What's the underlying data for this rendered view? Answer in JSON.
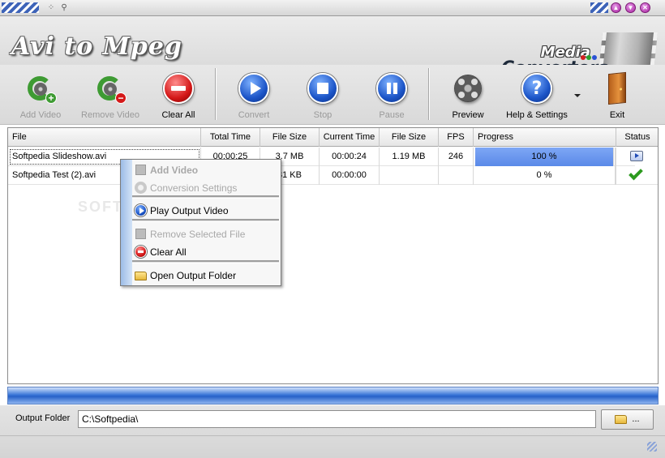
{
  "window": {
    "title_bar_buttons": [
      "minimize",
      "maximize",
      "close"
    ],
    "title_bar_icons": [
      "grip-icon",
      "pin-icon"
    ]
  },
  "banner": {
    "app_title": "Avi to Mpeg",
    "brand_line1": "Media",
    "brand_line2": "Converters",
    "brand_dot_colors": [
      "#d42020",
      "#2aa02a",
      "#2a52d4"
    ]
  },
  "toolbar": {
    "add_video": "Add Video",
    "remove_video": "Remove Video",
    "clear_all": "Clear All",
    "convert": "Convert",
    "stop": "Stop",
    "pause": "Pause",
    "preview": "Preview",
    "help_settings": "Help & Settings",
    "exit": "Exit"
  },
  "table": {
    "headers": {
      "file": "File",
      "total_time": "Total Time",
      "file_size": "File Size",
      "current_time": "Current Time",
      "out_file_size": "File Size",
      "fps": "FPS",
      "progress": "Progress",
      "status": "Status"
    },
    "rows": [
      {
        "file": "Softpedia Slideshow.avi",
        "total_time": "00:00:25",
        "file_size": "3.7 MB",
        "current_time": "00:00:24",
        "out_file_size": "1.19 MB",
        "fps": "246",
        "progress": "100 %",
        "progress_value": 1.0,
        "status_icon": "playing-status-icon"
      },
      {
        "file": "Softpedia Test (2).avi",
        "total_time": "",
        "file_size": "31 KB",
        "current_time": "00:00:00",
        "out_file_size": "",
        "fps": "",
        "progress": "0 %",
        "progress_value": 0.0,
        "status_icon": "check-icon"
      }
    ]
  },
  "context_menu": {
    "items": [
      {
        "label": "Add Video",
        "enabled": false
      },
      {
        "label": "Conversion Settings",
        "enabled": false
      },
      {
        "label": "Play Output Video",
        "enabled": true
      },
      {
        "label": "Remove Selected File",
        "enabled": false
      },
      {
        "label": "Clear All",
        "enabled": true
      },
      {
        "label": "Open Output Folder",
        "enabled": true
      }
    ]
  },
  "watermark": "SOFTPEDIA",
  "output": {
    "label": "Output Folder",
    "path": "C:\\Softpedia\\",
    "browse_label": "..."
  },
  "colors": {
    "accent_blue": "#2661c8",
    "progress_fill": "#6c97ee",
    "clear_red": "#d41818",
    "play_blue": "#1c55c8"
  }
}
